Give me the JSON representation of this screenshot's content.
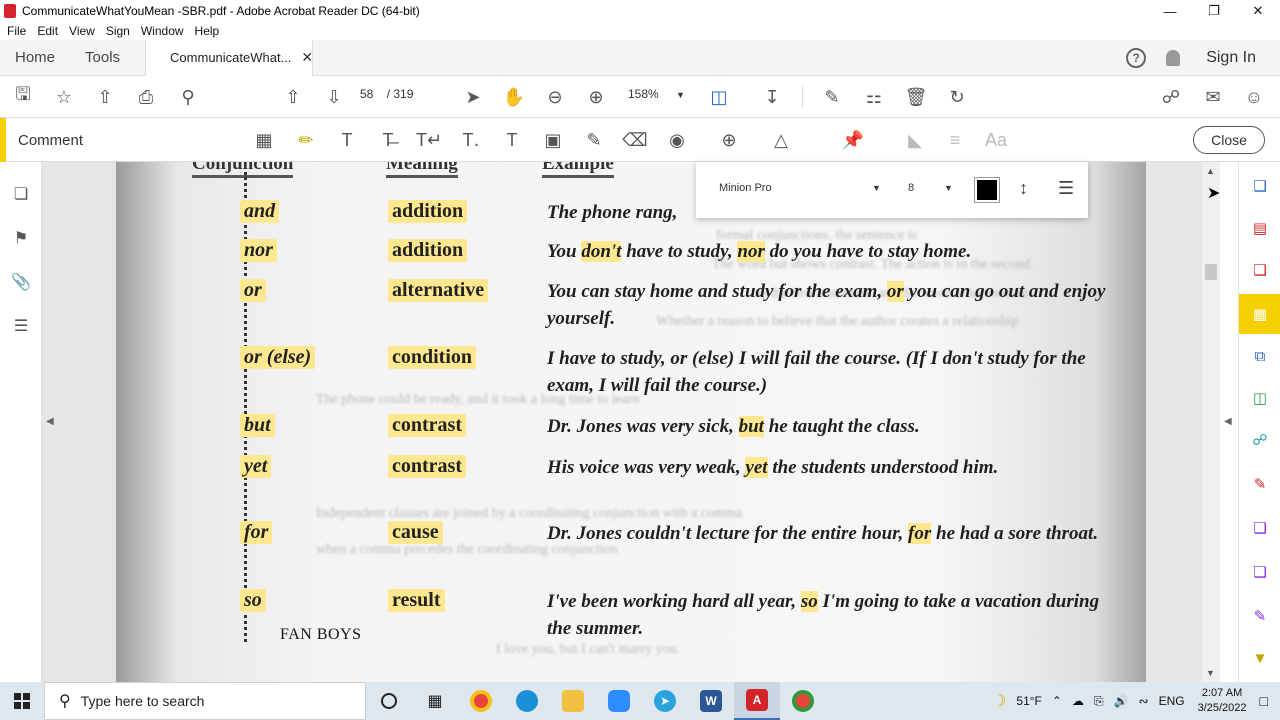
{
  "window": {
    "title": "CommunicateWhatYouMean -SBR.pdf - Adobe Acrobat Reader DC (64-bit)"
  },
  "menu": [
    "File",
    "Edit",
    "View",
    "Sign",
    "Window",
    "Help"
  ],
  "tabs": {
    "home": "Home",
    "tools": "Tools",
    "document": "CommunicateWhat...",
    "sign_in": "Sign In"
  },
  "toolbar": {
    "page_current": "58",
    "page_total": "/ 319",
    "zoom": "158%"
  },
  "comment_bar": {
    "label": "Comment",
    "close": "Close"
  },
  "properties": {
    "font": "Minion Pro",
    "size": "8",
    "color": "#000000"
  },
  "document": {
    "headers": {
      "conjunction": "Conjunction",
      "meaning": "Meaning",
      "example": "Example"
    },
    "rows": [
      {
        "conj": "and",
        "meaning": "addition",
        "ex_pre": "The phone rang, ",
        "ex_hl": "",
        "ex_post": ""
      },
      {
        "conj": "nor",
        "meaning": "addition",
        "ex_pre": "You ",
        "ex_hl": "don't",
        "ex_mid": " have to study, ",
        "ex_hl2": "nor",
        "ex_post": " do you have to stay home."
      },
      {
        "conj": "or",
        "meaning": "alternative",
        "ex_pre": "You can stay home and study for the exam, ",
        "ex_hl": "or",
        "ex_post": " you can go out and enjoy yourself."
      },
      {
        "conj": "or (else)",
        "meaning": "condition",
        "ex_pre": "I have to study, or (else) I will fail the course. (If I don't study for the exam, I will fail the course.)",
        "ex_hl": "",
        "ex_post": ""
      },
      {
        "conj": "but",
        "meaning": "contrast",
        "ex_pre": "Dr. Jones was very sick, ",
        "ex_hl": "but",
        "ex_post": " he taught the class."
      },
      {
        "conj": "yet",
        "meaning": "contrast",
        "ex_pre": "His voice was very weak, ",
        "ex_hl": "yet",
        "ex_post": " the students understood him."
      },
      {
        "conj": "for",
        "meaning": "cause",
        "ex_pre": "Dr. Jones couldn't lecture for the entire hour, ",
        "ex_hl": "for",
        "ex_post": " he had a sore throat."
      },
      {
        "conj": "so",
        "meaning": "result",
        "ex_pre": "I've been working hard all year, ",
        "ex_hl": "so",
        "ex_post": " I'm going to take a vacation during the summer."
      }
    ],
    "note": "FAN BOYS"
  },
  "taskbar": {
    "search_placeholder": "Type here to search",
    "weather": "51°F",
    "language": "ENG",
    "time": "2:07 AM",
    "date": "3/25/2022"
  }
}
